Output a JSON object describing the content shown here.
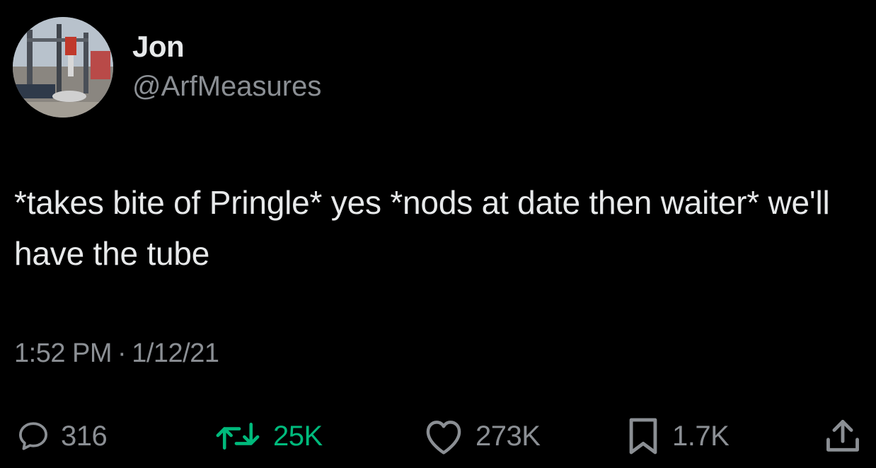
{
  "author": {
    "display_name": "Jon",
    "handle": "@ArfMeasures",
    "avatar_icon": "profile-avatar-photo"
  },
  "tweet": {
    "text": "*takes bite of Pringle* yes *nods at date then waiter* we'll have the tube",
    "time": "1:52 PM",
    "separator": "·",
    "date": "1/12/21"
  },
  "actions": {
    "replies": "316",
    "retweets": "25K",
    "likes": "273K",
    "bookmarks": "1.7K"
  },
  "colors": {
    "background": "#000000",
    "text": "#e7e9ea",
    "secondary": "#8b8f94",
    "retweet_accent": "#00ba7c"
  }
}
